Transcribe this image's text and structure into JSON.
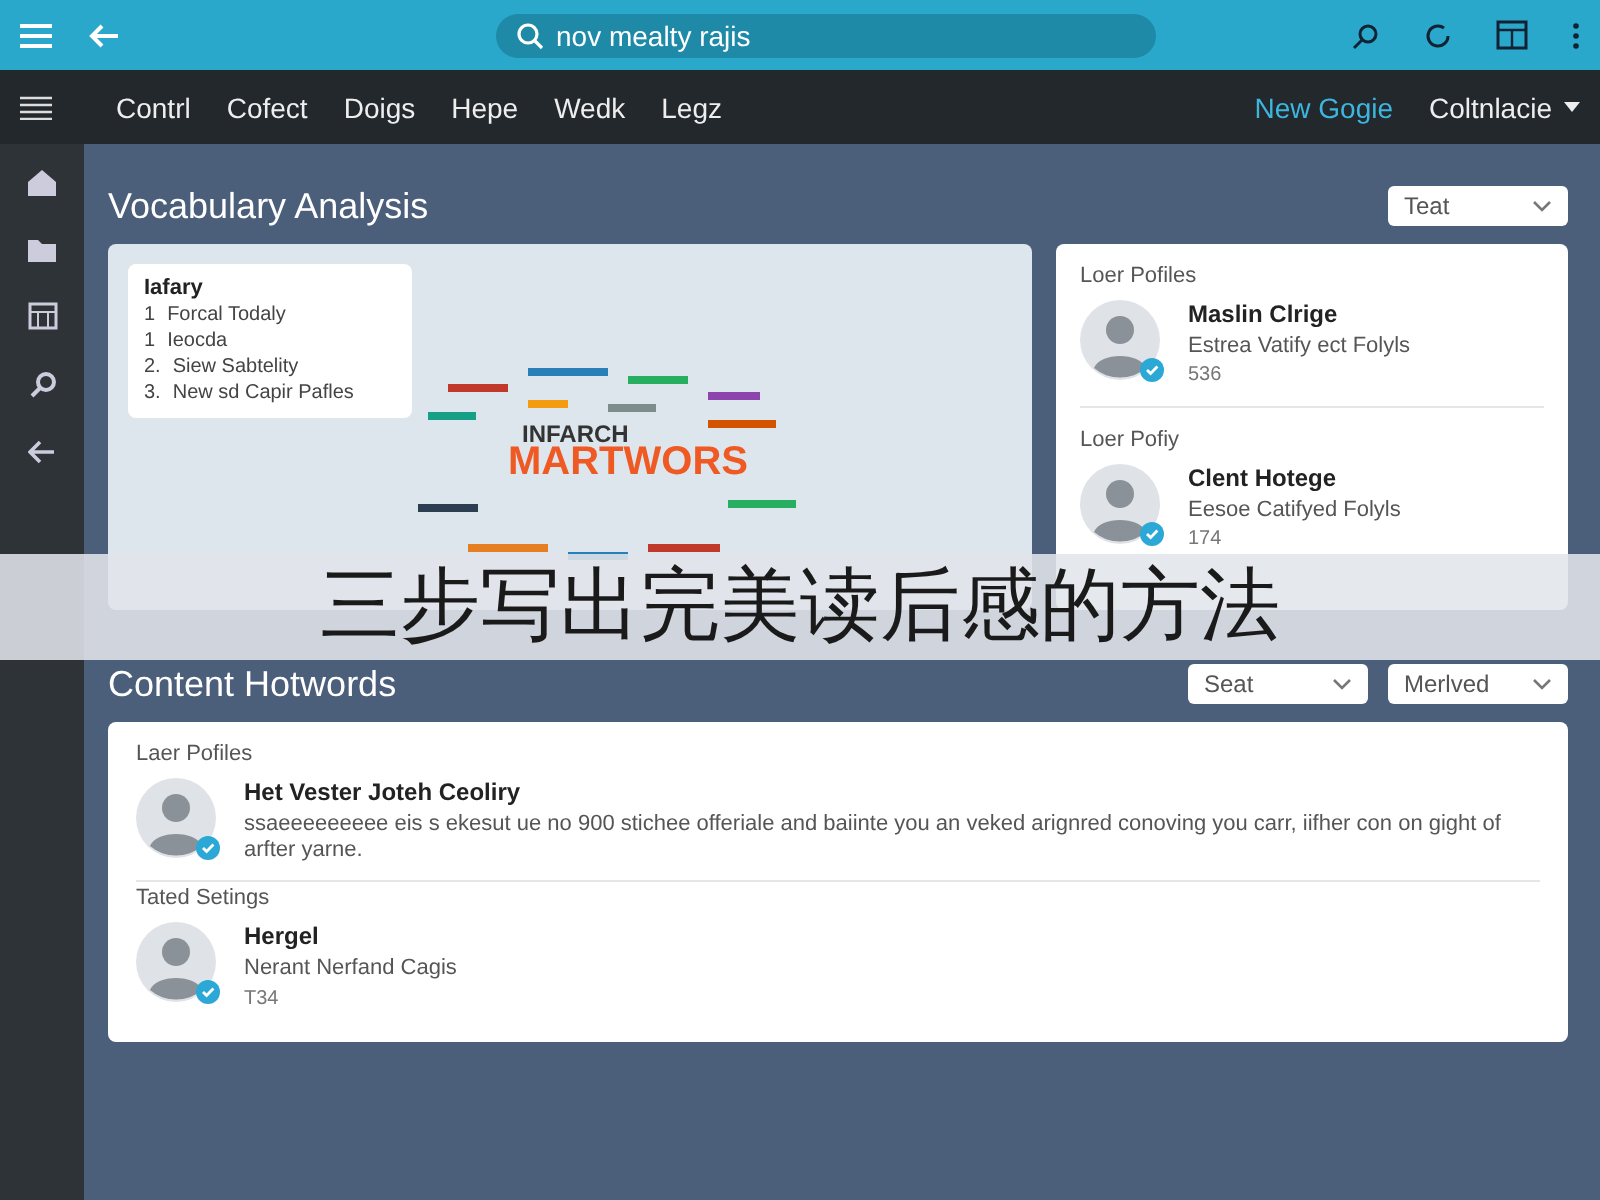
{
  "top_bar": {
    "search": {
      "value": "nov mealty rajis"
    }
  },
  "nav": {
    "items": [
      "Contrl",
      "Cofect",
      "Doigs",
      "Hepe",
      "Wedk",
      "Legz"
    ],
    "link": "New Gogie",
    "dropdown": "Coltnlacie"
  },
  "analysis": {
    "title": "Vocabulary Analysis",
    "select": "Teat",
    "callout": {
      "title": "Iafary",
      "items": [
        {
          "number": "1",
          "text": "Forcal Todaly"
        },
        {
          "number": "1",
          "text": "Ieocda"
        },
        {
          "number": "2.",
          "text": "Siew Sabtelity"
        },
        {
          "number": "3.",
          "text": "New sd Capir Pafles"
        }
      ]
    },
    "word_cloud": {
      "subtitle": "INFARCH",
      "headline": "MARTWORS"
    },
    "profiles": [
      {
        "heading": "Loer Pofiles",
        "name": "Maslin Clrige",
        "description": "Estrea Vatify ect Folyls",
        "count": "536"
      },
      {
        "heading": "Loer Pofiy",
        "name": "Clent Hotege",
        "description": "Eesoe Catifyed Folyls",
        "count": "174"
      }
    ]
  },
  "banner": {
    "text": "三步写出完美读后感的方法"
  },
  "hotwords": {
    "title": "Content Hotwords",
    "selects": [
      "Seat",
      "Merlved"
    ],
    "entries": [
      {
        "heading": "Laer Pofiles",
        "name": "Het Vester Joteh Ceoliry",
        "description": "ssaeeeeeeeee eis s ekesut ue no 900 stichee offeriale and baiinte you an veked arignred conoving you carr, iifher con on gight of arfter yarne."
      },
      {
        "heading": "Tated Setings",
        "name": "Hergel",
        "description": "Nerant Nerfand Cagis",
        "count": "T34"
      }
    ]
  }
}
